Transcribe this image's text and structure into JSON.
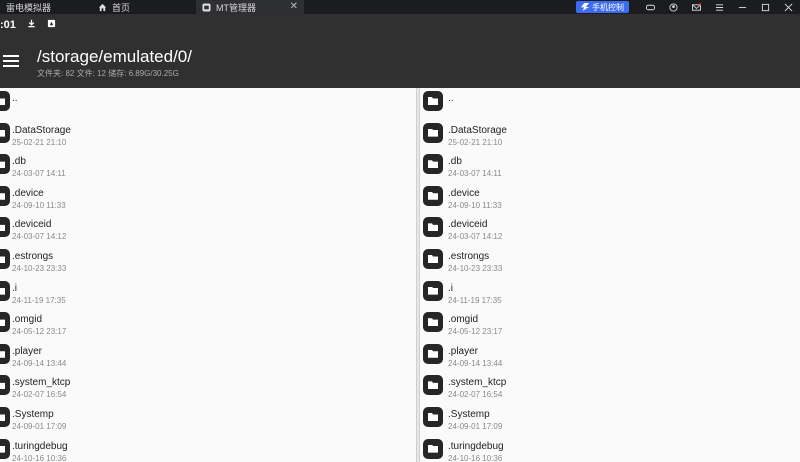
{
  "emulator": {
    "tabs": [
      {
        "label": "雷电模拟器"
      },
      {
        "label": "首页"
      },
      {
        "label": "MT管理器"
      }
    ],
    "phone_control_label": "手机控制"
  },
  "status_bar": {
    "time": ":01"
  },
  "header": {
    "path": "/storage/emulated/0/",
    "summary": "文件夹: 82  文件: 12  储存: 6.89G/30.25G"
  },
  "files": [
    {
      "name": "..",
      "date": ""
    },
    {
      "name": ".DataStorage",
      "date": "25-02-21 21:10"
    },
    {
      "name": ".db",
      "date": "24-03-07 14:11"
    },
    {
      "name": ".device",
      "date": "24-09-10 11:33"
    },
    {
      "name": ".deviceid",
      "date": "24-03-07 14:12"
    },
    {
      "name": ".estrongs",
      "date": "24-10-23 23:33"
    },
    {
      "name": ".i",
      "date": "24-11-19 17:35"
    },
    {
      "name": ".omgid",
      "date": "24-05-12 23:17"
    },
    {
      "name": ".player",
      "date": "24-09-14 13:44"
    },
    {
      "name": ".system_ktcp",
      "date": "24-02-07 16:54"
    },
    {
      "name": ".Systemp",
      "date": "24-09-01 17:09"
    },
    {
      "name": ".turingdebug",
      "date": "24-10-16 10:36"
    }
  ]
}
